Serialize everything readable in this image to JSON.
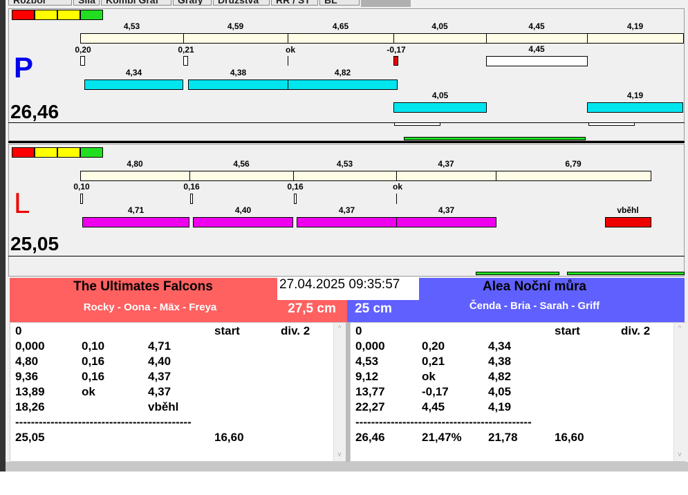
{
  "tabs": [
    "Rozbor",
    "Síla",
    "Kombi Graf",
    "Grafy",
    "Družstva",
    "RR / ST",
    "BL"
  ],
  "colors": {
    "red": "#ff0000",
    "yellow": "#ffff00",
    "green": "#22dd22",
    "cream": "#fffde6",
    "cyan": "#00e5ee",
    "magenta": "#ee00ee",
    "team_left": "#ff6060",
    "team_right": "#6060ff"
  },
  "lane_p": {
    "letter": "P",
    "score": "26,46",
    "top_labels": [
      "4,53",
      "4,59",
      "4,65",
      "4,05",
      "4,45",
      "4,19"
    ],
    "mid_labels": [
      "0,20",
      "0,21",
      "ok",
      "-0,17",
      "4,45"
    ],
    "bar_labels": [
      "4,34",
      "4,38",
      "4,82",
      "4,05",
      "4,19"
    ]
  },
  "lane_l": {
    "letter": "L",
    "score": "25,05",
    "top_labels": [
      "4,80",
      "4,56",
      "4,53",
      "4,37",
      "6,79"
    ],
    "mid_labels": [
      "0,10",
      "0,16",
      "0,16",
      "ok"
    ],
    "bar_labels": [
      "4,71",
      "4,40",
      "4,37",
      "4,37",
      "vběhl"
    ]
  },
  "timestamp": "27.04.2025 09:35:57",
  "left_team": {
    "name": "The Ultimates Falcons",
    "players": "Rocky - Oona - Mäx - Freya",
    "distance": "27,5 cm",
    "rows": [
      [
        "0",
        "",
        "",
        "start",
        "div. 2"
      ],
      [
        "0,000",
        "0,10",
        "4,71",
        "",
        ""
      ],
      [
        "4,80",
        "0,16",
        "4,40",
        "",
        ""
      ],
      [
        "9,36",
        "0,16",
        "4,37",
        "",
        ""
      ],
      [
        "13,89",
        "ok",
        "4,37",
        "",
        ""
      ],
      [
        "18,26",
        "",
        "vběhl",
        "",
        ""
      ],
      [
        "---------------------------------------------",
        "",
        "",
        "",
        ""
      ],
      [
        "25,05",
        "",
        "",
        "16,60",
        ""
      ]
    ]
  },
  "right_team": {
    "name": "Alea Noční můra",
    "players": "Čenda - Bria - Sarah - Griff",
    "distance": "25 cm",
    "rows": [
      [
        "0",
        "",
        "",
        "start",
        "div. 2"
      ],
      [
        "0,000",
        "0,20",
        "4,34",
        "",
        ""
      ],
      [
        "4,53",
        "0,21",
        "4,38",
        "",
        ""
      ],
      [
        "9,12",
        "ok",
        "4,82",
        "",
        ""
      ],
      [
        "13,77",
        "-0,17",
        "4,05",
        "",
        ""
      ],
      [
        "22,27",
        "4,45",
        "4,19",
        "",
        ""
      ],
      [
        "---------------------------------------------",
        "",
        "",
        "",
        ""
      ],
      [
        "26,46",
        "21,47%",
        "21,78",
        "16,60",
        ""
      ]
    ]
  }
}
